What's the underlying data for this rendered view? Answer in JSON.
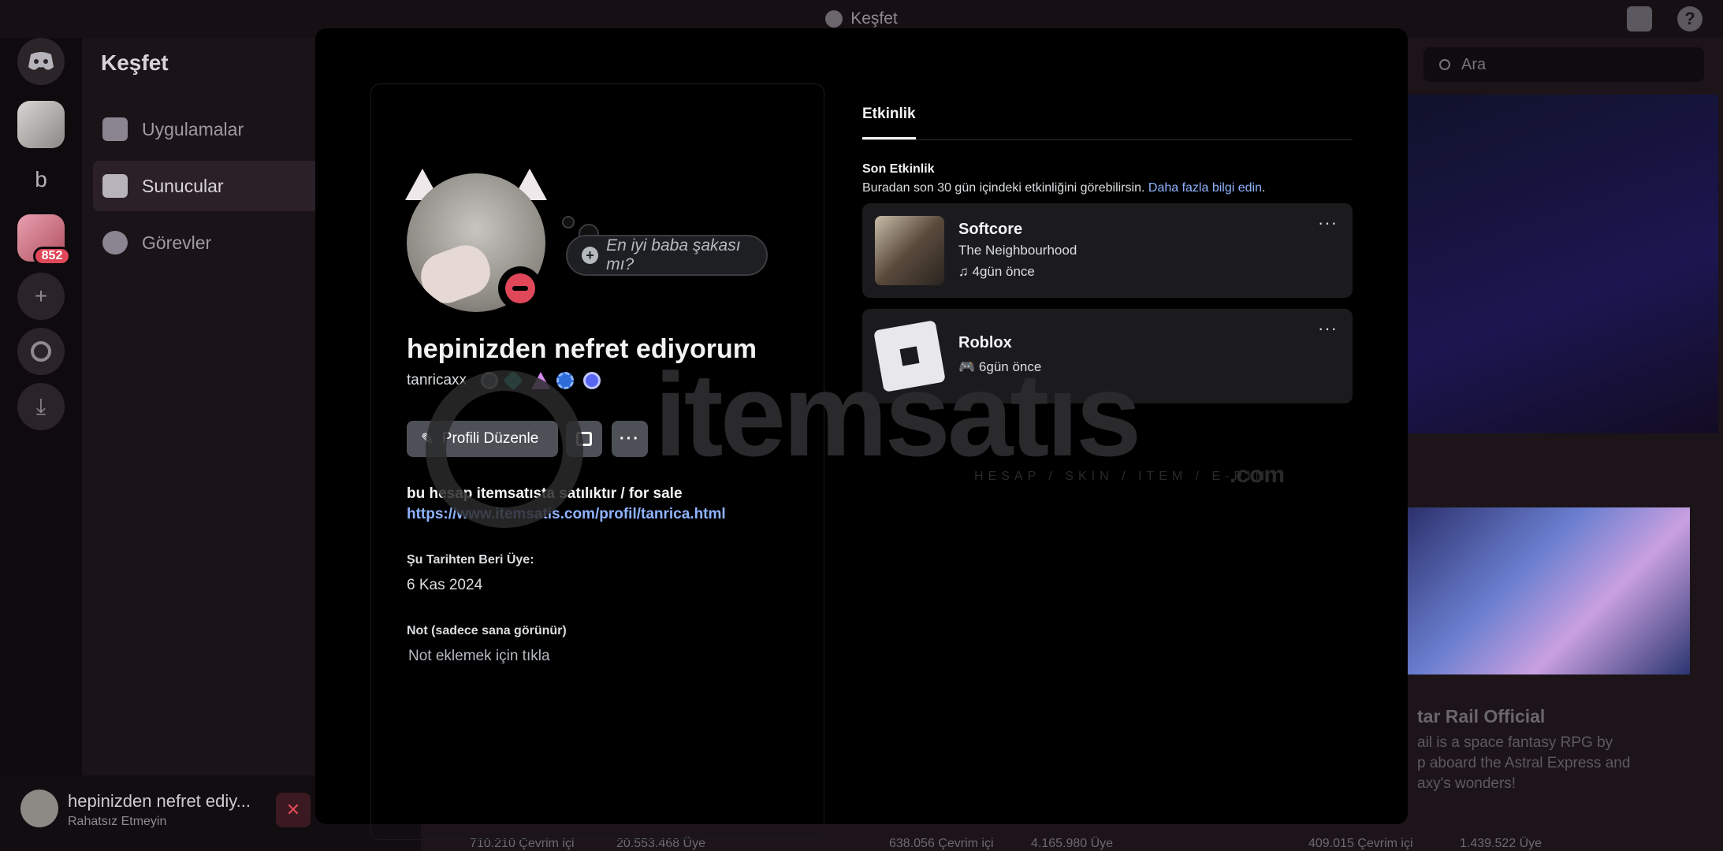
{
  "window": {
    "title": "Keşfet"
  },
  "guilds": {
    "unread_count": "852",
    "letter_server": "b"
  },
  "sidebar": {
    "title": "Keşfet",
    "items": [
      {
        "label": "Uygulamalar",
        "icon": "gamepad-icon"
      },
      {
        "label": "Sunucular",
        "icon": "server-icon",
        "active": true
      },
      {
        "label": "Görevler",
        "icon": "quest-icon"
      }
    ]
  },
  "search": {
    "placeholder": "Ara"
  },
  "background": {
    "card_title": "tar Rail Official",
    "card_desc_1": "ail is a space fantasy RPG by",
    "card_desc_2": "p aboard the Astral Express and",
    "card_desc_3": "axy's wonders!",
    "stats": [
      {
        "online": "710.210 Çevrim içi",
        "members": "20.553.468 Üye"
      },
      {
        "online": "638.056 Çevrim içi",
        "members": "4.165.980 Üye"
      },
      {
        "online": "409.015 Çevrim içi",
        "members": "1.439.522 Üye"
      }
    ]
  },
  "user_panel": {
    "name": "hepinizden nefret ediy...",
    "status": "Rahatsız Etmeyin"
  },
  "profile": {
    "bubble_placeholder": "En iyi baba şakası mı?",
    "display_name": "hepinizden nefret ediyorum",
    "username": "tanricaxx",
    "edit_button": "Profili Düzenle",
    "bio_line": "bu hesap itemsatısta satılıktır / for sale",
    "bio_link": "https://www.itemsatis.com/profil/tanrica.html",
    "member_since_label": "Şu Tarihten Beri Üye:",
    "member_since_value": "6 Kas 2024",
    "note_label": "Not (sadece sana görünür)",
    "note_placeholder": "Not eklemek için tıkla"
  },
  "activity": {
    "tab": "Etkinlik",
    "section_title": "Son Etkinlik",
    "section_desc": "Buradan son 30 gün içindeki etkinliğini görebilirsin.",
    "learn_more": "Daha fazla bilgi edin",
    "items": [
      {
        "title": "Softcore",
        "subtitle": "The Neighbourhood",
        "meta": "4gün önce",
        "icon": "music-note-icon"
      },
      {
        "title": "Roblox",
        "subtitle": "",
        "meta": "6gün önce",
        "icon": "gamepad-icon"
      }
    ]
  },
  "watermark": {
    "text": "itemsatıs",
    "tagline": "HESAP / SKIN / ITEM / E-PIN",
    "suffix": ".com"
  }
}
